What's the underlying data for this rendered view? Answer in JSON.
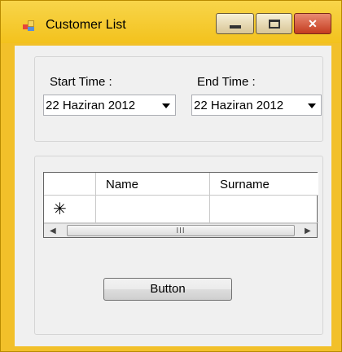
{
  "window": {
    "title": "Customer List",
    "icon": "app-form-icon",
    "controls": {
      "minimize": "minimize-icon",
      "maximize": "maximize-icon",
      "close": "close-icon"
    }
  },
  "filters": {
    "start_label": "Start Time :",
    "start_value": "22 Haziran 2012",
    "end_label": "End Time :",
    "end_value": "22 Haziran 2012"
  },
  "grid": {
    "columns": [
      "Name",
      "Surname"
    ],
    "new_row_marker": "✳",
    "scroll_grip": "III"
  },
  "action": {
    "button_label": "Button"
  }
}
